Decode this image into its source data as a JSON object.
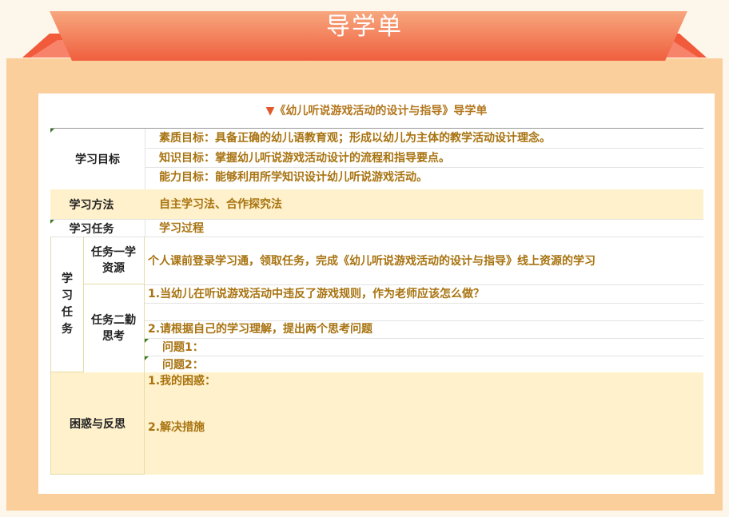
{
  "banner": {
    "title": "导学单"
  },
  "doc": {
    "title": "《幼儿听说游戏活动的设计与指导》导学单",
    "title_marker": "▼"
  },
  "goals": {
    "label": "学习目标",
    "items": [
      "素质目标：具备正确的幼儿语教育观；形成以幼儿为主体的教学活动设计理念。",
      "知识目标：掌握幼儿听说游戏活动设计的流程和指导要点。",
      "能力目标：能够利用所学知识设计幼儿听说游戏活动。"
    ]
  },
  "methods": {
    "label": "学习方法",
    "value": "自主学习法、合作探究法"
  },
  "tasks_header": {
    "label": "学习任务",
    "value": "学习过程"
  },
  "tasks": {
    "label": "学习任务",
    "task1": {
      "label": "任务一学资源",
      "content": "个人课前登录学习通，领取任务，完成《幼儿听说游戏活动的设计与指导》线上资源的学习"
    },
    "task2": {
      "label": "任务二勤思考",
      "q1": "1.当幼儿在听说游戏活动中违反了游戏规则，作为老师应该怎么做？",
      "q2": "2.请根据自己的学习理解，提出两个思考问题",
      "q2a": "问题1：",
      "q2b": "问题2："
    }
  },
  "reflection": {
    "label": "困惑与反思",
    "item1": "1.我的困惑：",
    "item2": "2.解决措施"
  }
}
